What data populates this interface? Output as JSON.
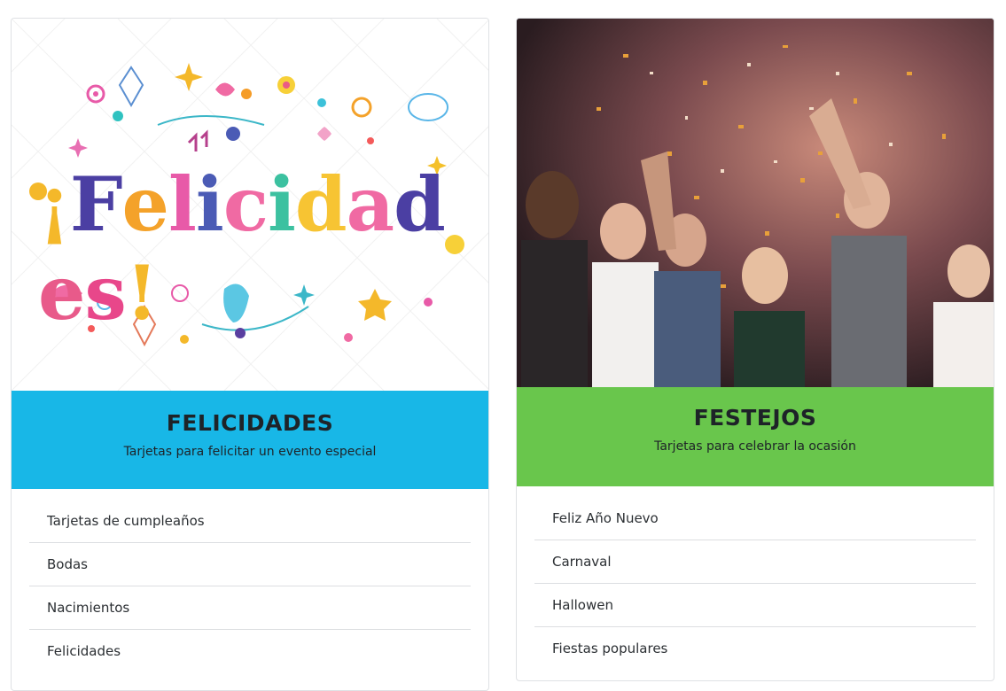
{
  "cards": [
    {
      "image_text": "¡Felicidades!",
      "title": "FELICIDADES",
      "subtitle": "Tarjetas para felicitar un evento especial",
      "band_color": "#18b7e7",
      "items": [
        {
          "label": "Tarjetas de cumpleaños"
        },
        {
          "label": "Bodas"
        },
        {
          "label": "Nacimientos"
        },
        {
          "label": "Felicidades"
        }
      ]
    },
    {
      "title": "FESTEJOS",
      "subtitle": "Tarjetas para celebrar la ocasión",
      "band_color": "#69c64c",
      "items": [
        {
          "label": "Feliz Año Nuevo"
        },
        {
          "label": "Carnaval"
        },
        {
          "label": "Hallowen"
        },
        {
          "label": "Fiestas populares"
        }
      ]
    }
  ]
}
